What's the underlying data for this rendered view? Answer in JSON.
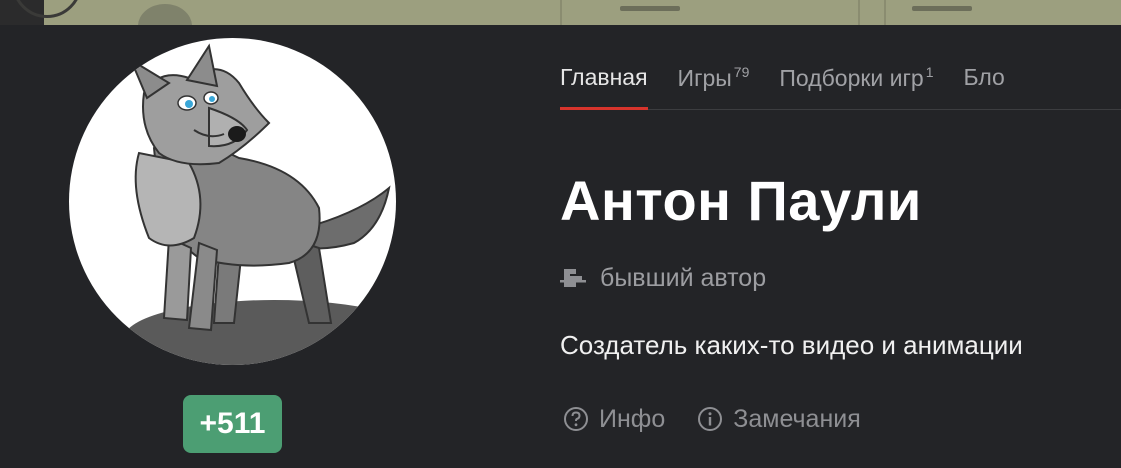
{
  "profile": {
    "name": "Антон Паули",
    "status": "бывший автор",
    "status_icon": "ex-author-badge-icon",
    "bio": "Создатель каких-то видео и анимации",
    "rating": "+511",
    "avatar_icon": "wolf-avatar-icon"
  },
  "tabs": [
    {
      "label": "Главная",
      "count": "",
      "active": true
    },
    {
      "label": "Игры",
      "count": "79",
      "active": false
    },
    {
      "label": "Подборки игр",
      "count": "1",
      "active": false
    },
    {
      "label": "Бло",
      "count": "",
      "active": false
    }
  ],
  "links": [
    {
      "label": "Инфо",
      "icon": "question-circle-icon"
    },
    {
      "label": "Замечания",
      "icon": "info-circle-icon"
    }
  ],
  "colors": {
    "background": "#232427",
    "accent": "#d7342c",
    "rating_badge": "#4c9e73"
  }
}
